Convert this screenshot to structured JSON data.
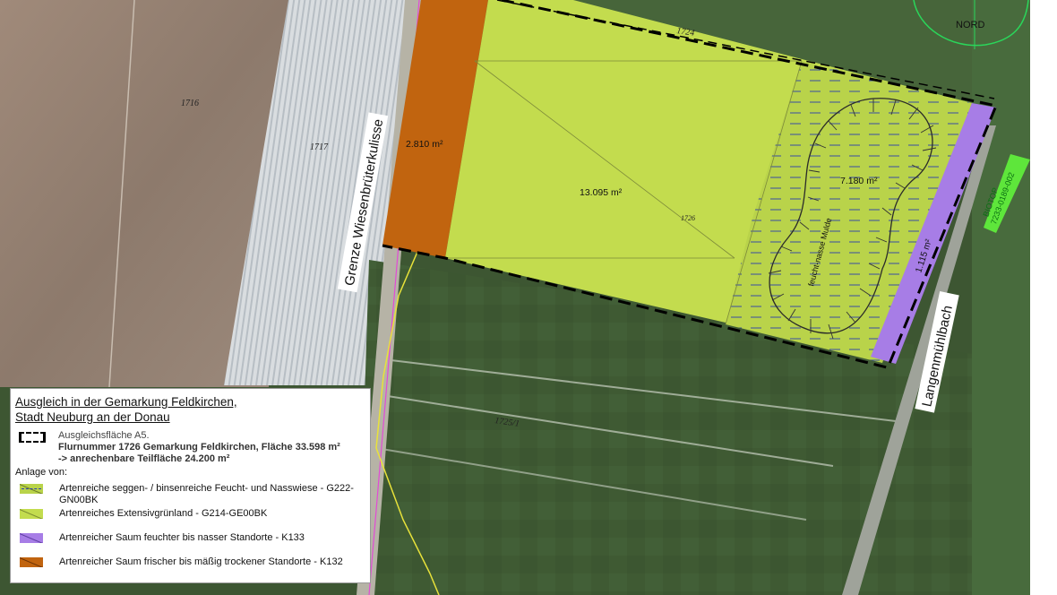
{
  "map": {
    "parcel_numbers": {
      "p1716": "1716",
      "p1717": "1717",
      "p1724": "1724",
      "p1726": "1726",
      "p1725": "1725/1"
    },
    "areas": {
      "orange_strip": "2.810 m²",
      "extensive_meadow": "13.095 m²",
      "wet_meadow": "7.180 m²",
      "purple_strip": "1.115 m²"
    },
    "hollow_label": "feucht-nasse Mulde",
    "road_label_left": "Grenze Wiesenbrüterkulisse",
    "stream_label": "Langenmühlbach",
    "biotope_label": "BIOTOP",
    "biotope_id": "7233-0189-002",
    "north_label": "NORD"
  },
  "legend": {
    "title_line1": "Ausgleich in der Gemarkung Feldkirchen,",
    "title_line2": "Stadt Neuburg an der Donau",
    "a5_name": "Ausgleichsfläche  A5.",
    "a5_line2": "Flurnummer 1726 Gemarkung Feldkirchen, Fläche 33.598 m²",
    "a5_line3": "  -> anrechenbare Teilfläche 24.200 m²",
    "anlage_label": "Anlage von:",
    "items": [
      {
        "label": "Artenreiche seggen- / binsenreiche Feucht- und Nasswiese - G222-GN00BK",
        "color": "#b9d34a"
      },
      {
        "label": "Artenreiches Extensivgrünland - G214-GE00BK",
        "color": "#c3dc4e"
      },
      {
        "label": "Artenreicher Saum feuchter bis nasser Standorte - K133",
        "color": "#a77de6"
      },
      {
        "label": "Artenreicher Saum frischer bis mäßig trockener Standorte  - K132",
        "color": "#c1640f"
      }
    ]
  },
  "colors": {
    "wet_meadow": "#b9d34a",
    "extensive_meadow": "#c3dc4e",
    "purple_strip": "#a77de6",
    "orange_strip": "#c1640f",
    "biotope": "#5ee63b"
  }
}
